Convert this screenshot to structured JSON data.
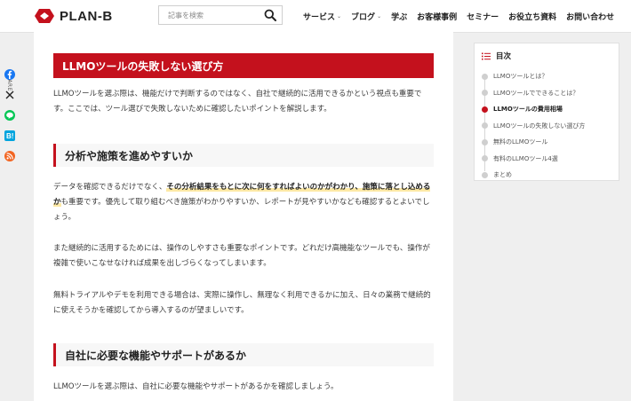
{
  "colors": {
    "accent": "#c4111d",
    "facebook": "#1877f2",
    "line": "#06c755",
    "hatena": "#00a4de",
    "rss": "#f26522"
  },
  "header": {
    "logo_text": "PLAN-B",
    "search": {
      "placeholder": "記事を検索"
    },
    "nav": [
      {
        "label": "サービス",
        "caret": "⌄"
      },
      {
        "label": "ブログ",
        "caret": "⌄"
      },
      {
        "label": "学ぶ"
      },
      {
        "label": "お客様事例"
      },
      {
        "label": "セミナー"
      },
      {
        "label": "お役立ち資料"
      },
      {
        "label": "お問い合わせ"
      }
    ]
  },
  "share": {
    "label": "SHARE",
    "icons": [
      "facebook-icon",
      "x-icon",
      "line-icon",
      "hatena-icon",
      "rss-icon"
    ]
  },
  "article": {
    "h2": "LLMOツールの失敗しない選び方",
    "intro": "LLMOツールを選ぶ際は、機能だけで判断するのではなく、自社で継続的に活用できるかという視点も重要です。ここでは、ツール選びで失敗しないために確認したいポイントを解説します。",
    "sections": [
      {
        "heading": "分析や施策を進めやすいか",
        "p1_before": "データを確認できるだけでなく、",
        "p1_highlight": "その分析結果をもとに次に何をすればよいのかがわかり、施策に落とし込めるか",
        "p1_after": "も重要です。優先して取り組むべき施策がわかりやすいか、レポートが見やすいかなども確認するとよいでしょう。",
        "p2": "また継続的に活用するためには、操作のしやすさも重要なポイントです。どれだけ高機能なツールでも、操作が複雑で使いこなせなければ成果を出しづらくなってしまいます。",
        "p3": "無料トライアルやデモを利用できる場合は、実際に操作し、無理なく利用できるかに加え、日々の業務で継続的に使えそうかを確認してから導入するのが望ましいです。"
      },
      {
        "heading": "自社に必要な機能やサポートがあるか",
        "p1": "LLMOツールを選ぶ際は、自社に必要な機能やサポートがあるかを確認しましょう。"
      }
    ]
  },
  "toc": {
    "title": "目次",
    "items": [
      {
        "label": "LLMOツールとは？",
        "active": false
      },
      {
        "label": "LLMOツールでできることは？",
        "active": false
      },
      {
        "label": "LLMOツールの費用相場",
        "active": true
      },
      {
        "label": "LLMOツールの失敗しない選び方",
        "active": false
      },
      {
        "label": "無料のLLMOツール",
        "active": false
      },
      {
        "label": "有料のLLMOツール4選",
        "active": false
      },
      {
        "label": "まとめ",
        "active": false
      }
    ]
  }
}
